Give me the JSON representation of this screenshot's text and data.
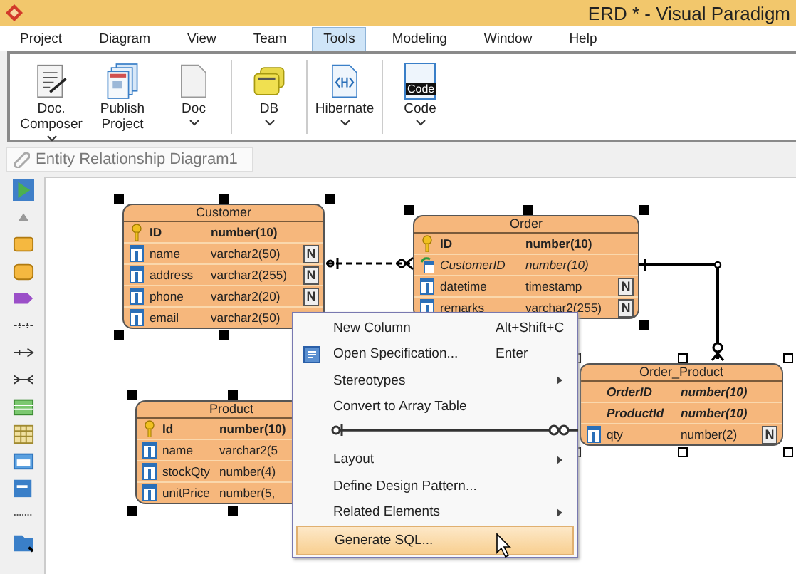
{
  "window": {
    "title": "ERD * - Visual Paradigm"
  },
  "menu_tabs": [
    {
      "label": "Project",
      "selected": false
    },
    {
      "label": "Diagram",
      "selected": false
    },
    {
      "label": "View",
      "selected": false
    },
    {
      "label": "Team",
      "selected": false
    },
    {
      "label": "Tools",
      "selected": true
    },
    {
      "label": "Modeling",
      "selected": false
    },
    {
      "label": "Window",
      "selected": false
    },
    {
      "label": "Help",
      "selected": false
    }
  ],
  "ribbon": {
    "groups": [
      [
        {
          "kind": "composer",
          "label": "Doc. Composer",
          "dropdown": true
        },
        {
          "kind": "publish",
          "label": "Publish Project",
          "dropdown": false
        },
        {
          "kind": "doc",
          "label": "Doc",
          "dropdown": true
        }
      ],
      [
        {
          "kind": "db",
          "label": "DB",
          "dropdown": true
        }
      ],
      [
        {
          "kind": "hibernate",
          "label": "Hibernate",
          "dropdown": true
        }
      ],
      [
        {
          "kind": "code",
          "label": "Code",
          "dropdown": true,
          "icon_text": "Code"
        }
      ]
    ]
  },
  "breadcrumb": "Entity Relationship Diagram1",
  "entities": [
    {
      "name": "Customer",
      "selected": true,
      "columns": [
        {
          "kind": "primary_key",
          "name": "ID",
          "type": "number(10)"
        },
        {
          "kind": "column",
          "name": "name",
          "type": "varchar2(50)",
          "null_badge": "N"
        },
        {
          "kind": "column",
          "name": "address",
          "type": "varchar2(255)",
          "null_badge": "N"
        },
        {
          "kind": "column",
          "name": "phone",
          "type": "varchar2(20)",
          "null_badge": "N"
        },
        {
          "kind": "column",
          "name": "email",
          "type": "varchar2(50)"
        }
      ]
    },
    {
      "name": "Order",
      "selected": true,
      "columns": [
        {
          "kind": "primary_key",
          "name": "ID",
          "type": "number(10)"
        },
        {
          "kind": "foreign_key",
          "name": "CustomerID",
          "type": "number(10)"
        },
        {
          "kind": "column",
          "name": "datetime",
          "type": "timestamp",
          "null_badge": "N"
        },
        {
          "kind": "column",
          "name": "remarks",
          "type": "varchar2(255)",
          "null_badge": "N"
        }
      ]
    },
    {
      "name": "Product",
      "selected": true,
      "columns": [
        {
          "kind": "primary_key",
          "name": "Id",
          "type": "number(10)"
        },
        {
          "kind": "column",
          "name": "name",
          "type": "varchar2(5"
        },
        {
          "kind": "column",
          "name": "stockQty",
          "type": "number(4)"
        },
        {
          "kind": "column",
          "name": "unitPrice",
          "type": "number(5,"
        }
      ]
    },
    {
      "name": "Order_Product",
      "selected": false,
      "columns": [
        {
          "kind": "primary_foreign_key",
          "name": "OrderID",
          "type": "number(10)"
        },
        {
          "kind": "primary_foreign_key",
          "name": "ProductId",
          "type": "number(10)"
        },
        {
          "kind": "column",
          "name": "qty",
          "type": "number(2)",
          "null_badge": "N"
        }
      ]
    }
  ],
  "context_menu": [
    {
      "kind": "item",
      "label": "New Column",
      "shortcut": "Alt+Shift+C",
      "submenu": false,
      "highlighted": false
    },
    {
      "kind": "item",
      "label": "Open Specification...",
      "shortcut": "Enter",
      "submenu": false,
      "highlighted": false,
      "has_icon": true
    },
    {
      "kind": "item",
      "label": "Stereotypes",
      "submenu": true,
      "highlighted": false
    },
    {
      "kind": "item",
      "label": "Convert to Array Table",
      "submenu": false,
      "highlighted": false
    },
    {
      "kind": "covered"
    },
    {
      "kind": "item",
      "label": "Layout",
      "submenu": true,
      "highlighted": false
    },
    {
      "kind": "item",
      "label": "Define Design Pattern...",
      "submenu": false,
      "highlighted": false
    },
    {
      "kind": "item",
      "label": "Related Elements",
      "submenu": true,
      "highlighted": false
    },
    {
      "kind": "item",
      "label": "Generate SQL...",
      "submenu": false,
      "highlighted": true
    }
  ]
}
